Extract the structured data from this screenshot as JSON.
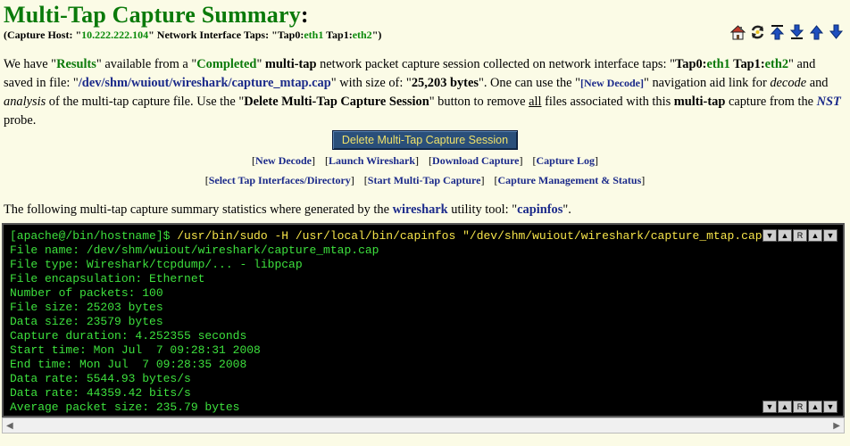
{
  "header": {
    "title": "Multi-Tap Capture Summary",
    "title_colon": ":",
    "capture_host_label": "(Capture Host: \"",
    "capture_host": "10.222.222.104",
    "interface_taps_label": "\"  Network Interface Taps: \"Tap0:",
    "tap0": "eth1",
    "tap1_label": "  Tap1:",
    "tap1": "eth2",
    "subtitle_end": "\")"
  },
  "toolbar_icons": [
    "home-icon",
    "refresh-icon",
    "scroll-top-icon",
    "scroll-bottom-icon",
    "page-up-icon",
    "page-down-icon"
  ],
  "intro": {
    "p1": "We have \"",
    "results": "Results",
    "p2": "\" available from a \"",
    "completed": "Completed",
    "p3": "\" ",
    "multitap": "multi-tap",
    "p4": " network packet capture session collected on network interface taps: \"",
    "tap0_label": "Tap0:",
    "tap0": "eth1",
    "tap1_label": "  Tap1:",
    "tap1": "eth2",
    "p5": "\" and saved in file: \"",
    "file": "/dev/shm/wuiout/wireshark/capture_mtap.cap",
    "p6": "\" with size of: \"",
    "size": "25,203 bytes",
    "p7": "\". One can use the \"",
    "new_decode": "[New Decode]",
    "p8": "\" navigation aid link for ",
    "decode": "decode",
    "p9": " and ",
    "analysis": "analysis",
    "p10": " of the multi-tap capture file. Use the \"",
    "delete_session": "Delete Multi-Tap Capture Session",
    "p11": "\" button to remove ",
    "all": "all",
    "p12": " files associated with this ",
    "multitap2": "multi-tap",
    "p13": " capture from the ",
    "nst": "NST",
    "p14": " probe."
  },
  "delete_button": "Delete Multi-Tap Capture Session",
  "links_row1": [
    "New Decode",
    "Launch Wireshark",
    "Download Capture",
    "Capture Log"
  ],
  "links_row2": [
    "Select Tap Interfaces/Directory",
    "Start Multi-Tap Capture",
    "Capture Management & Status"
  ],
  "stats_intro": {
    "p1": "The following multi-tap capture summary statistics where generated by the ",
    "tool": "wireshark",
    "p2": " utility tool: \"",
    "cmd": "capinfos",
    "p3": "\"."
  },
  "terminal": {
    "prompt": "[apache@/bin/hostname]$ ",
    "command": "/usr/bin/sudo -H /usr/local/bin/capinfos \"/dev/shm/wuiout/wireshark/capture_mtap.cap\";",
    "lines": [
      "File name: /dev/shm/wuiout/wireshark/capture_mtap.cap",
      "File type: Wireshark/tcpdump/... - libpcap",
      "File encapsulation: Ethernet",
      "Number of packets: 100",
      "File size: 25203 bytes",
      "Data size: 23579 bytes",
      "Capture duration: 4.252355 seconds",
      "Start time: Mon Jul  7 09:28:31 2008",
      "End time: Mon Jul  7 09:28:35 2008",
      "Data rate: 5544.93 bytes/s",
      "Data rate: 44359.42 bits/s",
      "Average packet size: 235.79 bytes"
    ],
    "controls": [
      "▼",
      "▲",
      "R",
      "▲",
      "▼"
    ]
  }
}
